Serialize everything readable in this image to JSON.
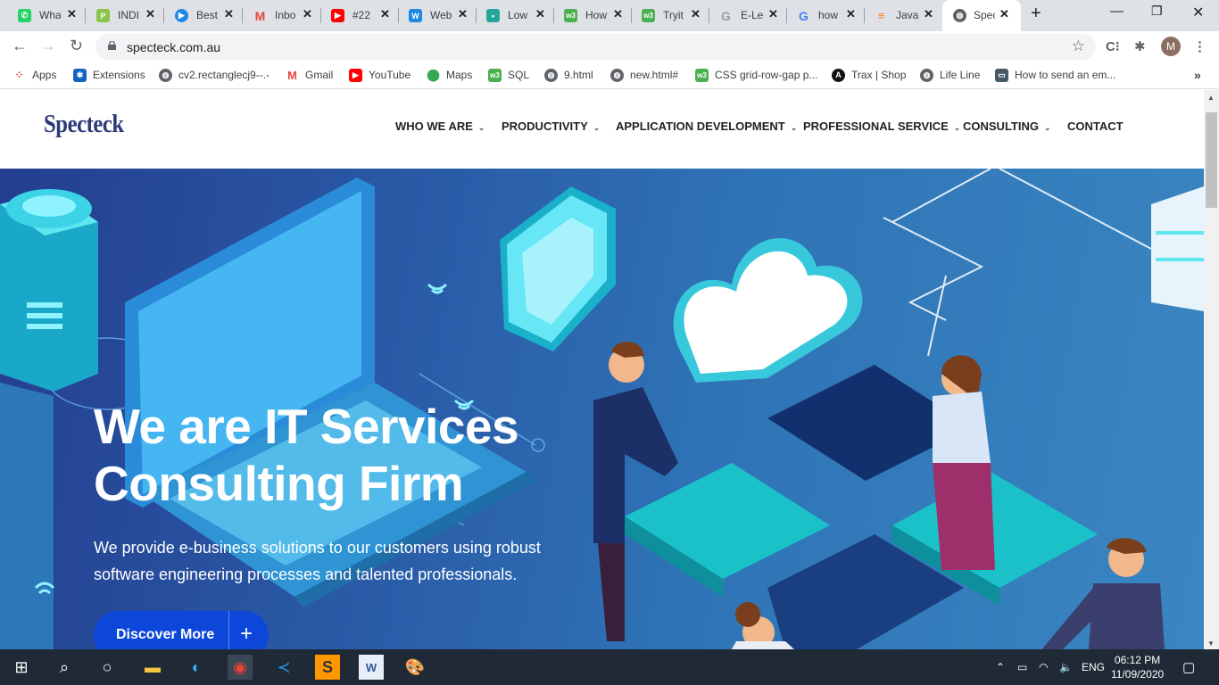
{
  "browser": {
    "tabs": [
      {
        "title": "Wha",
        "icon": "whatsapp-icon",
        "color": "#25d366"
      },
      {
        "title": "INDI",
        "icon": "p-icon",
        "color": "#8bc34a"
      },
      {
        "title": "Best",
        "icon": "play-icon",
        "color": "#2196f3"
      },
      {
        "title": "Inbo",
        "icon": "gmail-icon",
        "color": "#ea4335"
      },
      {
        "title": "#22",
        "icon": "youtube-icon",
        "color": "#ff0000"
      },
      {
        "title": "Web",
        "icon": "w-icon",
        "color": "#1e88e5"
      },
      {
        "title": "Low",
        "icon": "page-icon",
        "color": "#26a69a"
      },
      {
        "title": "How",
        "icon": "w3-icon",
        "color": "#4caf50"
      },
      {
        "title": "Tryit",
        "icon": "w3-icon",
        "color": "#4caf50"
      },
      {
        "title": "E-Le",
        "icon": "g-grey-icon",
        "color": "#9aa0a6"
      },
      {
        "title": "how",
        "icon": "google-icon",
        "color": "#4285f4"
      },
      {
        "title": "Java",
        "icon": "stackoverflow-icon",
        "color": "#f48024"
      },
      {
        "title": "Spec",
        "icon": "globe-icon",
        "color": "#5f6368",
        "active": true
      }
    ],
    "url": "specteck.com.au",
    "profile_initial": "M",
    "bookmarks": [
      {
        "label": "Apps",
        "icon": "apps-grid-icon"
      },
      {
        "label": "Extensions",
        "icon": "puzzle-icon"
      },
      {
        "label": "cv2.rectanglecj9--.-",
        "icon": "globe-icon"
      },
      {
        "label": "Gmail",
        "icon": "gmail-icon"
      },
      {
        "label": "YouTube",
        "icon": "youtube-icon"
      },
      {
        "label": "Maps",
        "icon": "maps-pin-icon"
      },
      {
        "label": "SQL",
        "icon": "w3-icon"
      },
      {
        "label": "9.html",
        "icon": "globe-icon"
      },
      {
        "label": "new.html#",
        "icon": "globe-icon"
      },
      {
        "label": "CSS grid-row-gap p...",
        "icon": "w3-icon"
      },
      {
        "label": "Trax | Shop",
        "icon": "angular-icon"
      },
      {
        "label": "Life Line",
        "icon": "globe-icon"
      },
      {
        "label": "How to send an em...",
        "icon": "laptop-icon"
      }
    ]
  },
  "site": {
    "logo": "Specteck",
    "menu": [
      "WHO WE ARE",
      "PRODUCTIVITY",
      "APPLICATION DEVELOPMENT",
      "PROFESSIONAL SERVICE",
      "CONSULTING",
      "CONTACT"
    ],
    "hero": {
      "title_line1": "We are IT Services",
      "title_line2": "Consulting Firm",
      "subtitle": "We provide e-business solutions to our customers using robust software engineering processes and talented professionals.",
      "cta_label": "Discover More",
      "cta_icon": "+"
    }
  },
  "taskbar": {
    "language": "ENG",
    "time": "06:12 PM",
    "date": "11/09/2020"
  }
}
